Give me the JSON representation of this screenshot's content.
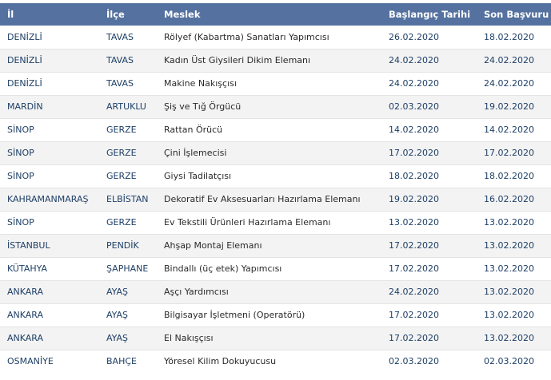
{
  "table": {
    "headers": [
      "İl",
      "İlçe",
      "Meslek",
      "Başlangıç Tarihi",
      "Son Başvuru Tarihi"
    ],
    "rows": [
      [
        "DENİZLİ",
        "TAVAS",
        "Rölyef (Kabartma) Sanatları Yapımcısı",
        "26.02.2020",
        "18.02.2020"
      ],
      [
        "DENİZLİ",
        "TAVAS",
        "Kadın Üst Giysileri Dikim Elemanı",
        "24.02.2020",
        "24.02.2020"
      ],
      [
        "DENİZLİ",
        "TAVAS",
        "Makine Nakışçısı",
        "24.02.2020",
        "24.02.2020"
      ],
      [
        "MARDİN",
        "ARTUKLU",
        "Şiş ve Tığ Örgücü",
        "02.03.2020",
        "19.02.2020"
      ],
      [
        "SİNOP",
        "GERZE",
        "Rattan Örücü",
        "14.02.2020",
        "14.02.2020"
      ],
      [
        "SİNOP",
        "GERZE",
        "Çini İşlemecisi",
        "17.02.2020",
        "17.02.2020"
      ],
      [
        "SİNOP",
        "GERZE",
        "Giysi Tadilatçısı",
        "18.02.2020",
        "18.02.2020"
      ],
      [
        "KAHRAMANMARAŞ",
        "ELBİSTAN",
        "Dekoratif Ev Aksesuarları Hazırlama Elemanı",
        "19.02.2020",
        "16.02.2020"
      ],
      [
        "SİNOP",
        "GERZE",
        "Ev Tekstili Ürünleri Hazırlama Elemanı",
        "13.02.2020",
        "13.02.2020"
      ],
      [
        "İSTANBUL",
        "PENDİK",
        "Ahşap Montaj Elemanı",
        "17.02.2020",
        "13.02.2020"
      ],
      [
        "KÜTAHYA",
        "ŞAPHANE",
        "Bindallı (üç etek) Yapımcısı",
        "17.02.2020",
        "13.02.2020"
      ],
      [
        "ANKARA",
        "AYAŞ",
        "Aşçı Yardımcısı",
        "24.02.2020",
        "13.02.2020"
      ],
      [
        "ANKARA",
        "AYAŞ",
        "Bilgisayar İşletmeni (Operatörü)",
        "17.02.2020",
        "13.02.2020"
      ],
      [
        "ANKARA",
        "AYAŞ",
        "El Nakışçısı",
        "17.02.2020",
        "13.02.2020"
      ],
      [
        "OSMANİYE",
        "BAHÇE",
        "Yöresel Kilim Dokuyucusu",
        "02.03.2020",
        "02.03.2020"
      ]
    ]
  },
  "colors": {
    "header_bg": "#54719f",
    "header_text": "#ffffff",
    "row_alt": "#f3f3f3",
    "link_text": "#1e3f66"
  }
}
